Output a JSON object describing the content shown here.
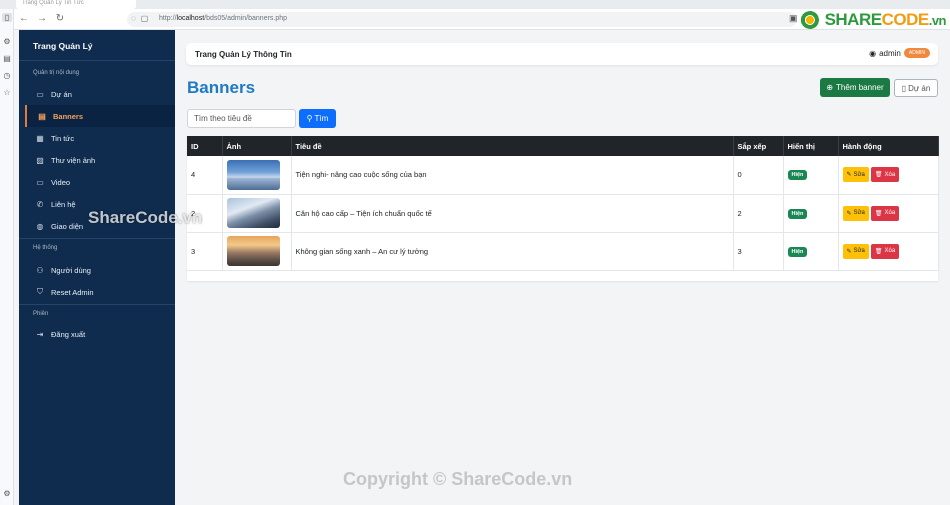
{
  "browser": {
    "tab_title": "Trang Quản Lý Tin Tức",
    "url_prefix": "http://",
    "url_host": "localhost",
    "url_path": "/bds05/admin/banners.php",
    "logo_share": "SHARE",
    "logo_code": "CODE",
    "logo_domain": ".vn"
  },
  "sidebar": {
    "brand": "Trang Quản Lý",
    "section_content": "Quản trị nội dung",
    "section_system": "Hệ thống",
    "section_session": "Phiên",
    "items": [
      {
        "label": "Dự án",
        "icon": "folder-icon"
      },
      {
        "label": "Banners",
        "icon": "banner-icon"
      },
      {
        "label": "Tin tức",
        "icon": "news-icon"
      },
      {
        "label": "Thư viện ảnh",
        "icon": "image-icon"
      },
      {
        "label": "Video",
        "icon": "video-icon"
      },
      {
        "label": "Liên hệ",
        "icon": "phone-icon"
      },
      {
        "label": "Giao diện",
        "icon": "palette-icon"
      },
      {
        "label": "Người dùng",
        "icon": "users-icon"
      },
      {
        "label": "Reset Admin",
        "icon": "shield-icon"
      },
      {
        "label": "Đăng xuất",
        "icon": "logout-icon"
      }
    ]
  },
  "topbar": {
    "title": "Trang Quản Lý Thông Tin",
    "user": "admin",
    "role_badge": "ADMIN"
  },
  "main": {
    "title": "Banners",
    "add_button": "Thêm banner",
    "projects_button": "Dự án",
    "search_placeholder": "Tìm theo tiêu đề",
    "search_button": "Tìm"
  },
  "table": {
    "columns": [
      "ID",
      "Ảnh",
      "Tiêu đề",
      "Sắp xếp",
      "Hiển thị",
      "Hành động"
    ],
    "rows": [
      {
        "id": "4",
        "title": "Tiện nghi- nâng cao cuộc sống của bạn",
        "order": "0",
        "status": "Hiện",
        "edit": "Sửa",
        "delete": "Xóa"
      },
      {
        "id": "2",
        "title": "Căn hộ cao cấp – Tiện ích chuẩn quốc tế",
        "order": "2",
        "status": "Hiện",
        "edit": "Sửa",
        "delete": "Xóa"
      },
      {
        "id": "3",
        "title": "Không gian sống xanh – An cư lý tưởng",
        "order": "3",
        "status": "Hiện",
        "edit": "Sửa",
        "delete": "Xóa"
      }
    ]
  },
  "watermark": {
    "side": "ShareCode.vn",
    "bottom": "Copyright © ShareCode.vn"
  },
  "colors": {
    "sidebar_bg": "#0f2c4f",
    "active_accent": "#f5a25d",
    "title_blue": "#1f7ac6",
    "success": "#1b7a43",
    "primary": "#0d6efd",
    "warning": "#ffc107",
    "danger": "#dc3545"
  }
}
